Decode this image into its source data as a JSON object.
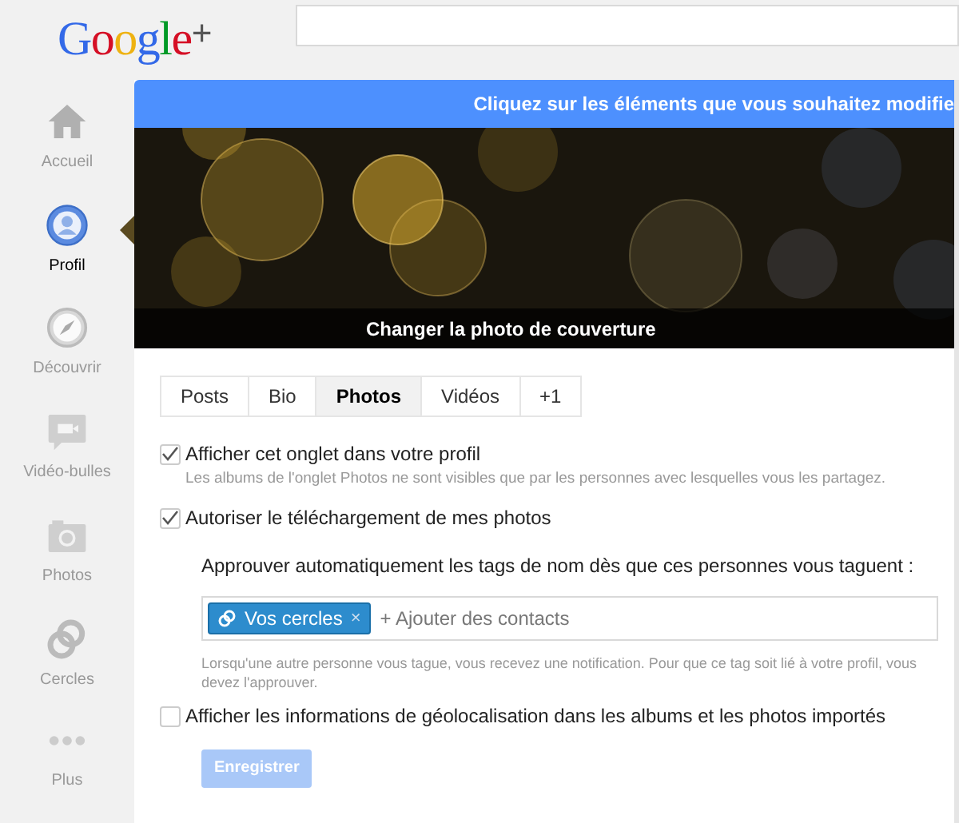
{
  "header": {
    "logo": "Google+"
  },
  "sidebar": {
    "items": [
      {
        "label": "Accueil",
        "kind": "home",
        "selected": false
      },
      {
        "label": "Profil",
        "kind": "profile",
        "selected": true
      },
      {
        "label": "Découvrir",
        "kind": "compass",
        "selected": false
      },
      {
        "label": "Vidéo-bulles",
        "kind": "video",
        "selected": false
      },
      {
        "label": "Photos",
        "kind": "camera",
        "selected": false
      },
      {
        "label": "Cercles",
        "kind": "circles",
        "selected": false
      },
      {
        "label": "Plus",
        "kind": "more",
        "selected": false
      }
    ]
  },
  "banner": "Cliquez sur les éléments que vous souhaitez modifie",
  "cover": {
    "caption": "Changer la photo de couverture"
  },
  "tabs": [
    {
      "label": "Posts",
      "selected": false
    },
    {
      "label": "Bio",
      "selected": false
    },
    {
      "label": "Photos",
      "selected": true
    },
    {
      "label": "Vidéos",
      "selected": false
    },
    {
      "label": "+1",
      "selected": false
    }
  ],
  "options": [
    {
      "label": "Afficher cet onglet dans votre profil",
      "checked": true,
      "hint": "Les albums de l'onglet Photos ne sont visibles que par les personnes avec lesquelles vous les partagez."
    },
    {
      "label": "Autoriser le téléchargement de mes photos",
      "checked": true
    }
  ],
  "auto_tag": {
    "label": "Approuver automatiquement les tags de nom dès que ces personnes vous taguent :",
    "chips": [
      {
        "label": "Vos cercles",
        "remove": "×"
      }
    ],
    "placeholder": "+ Ajouter des contacts",
    "hint": "Lorsqu'une autre personne vous tague, vous recevez une notification. Pour que ce tag soit lié à votre profil, vous devez l'approuver."
  },
  "geo_option": {
    "label": "Afficher les informations de géolocalisation dans les albums et les photos importés",
    "checked": false
  },
  "save_button": {
    "label": "Enregistrer",
    "disabled": true
  }
}
